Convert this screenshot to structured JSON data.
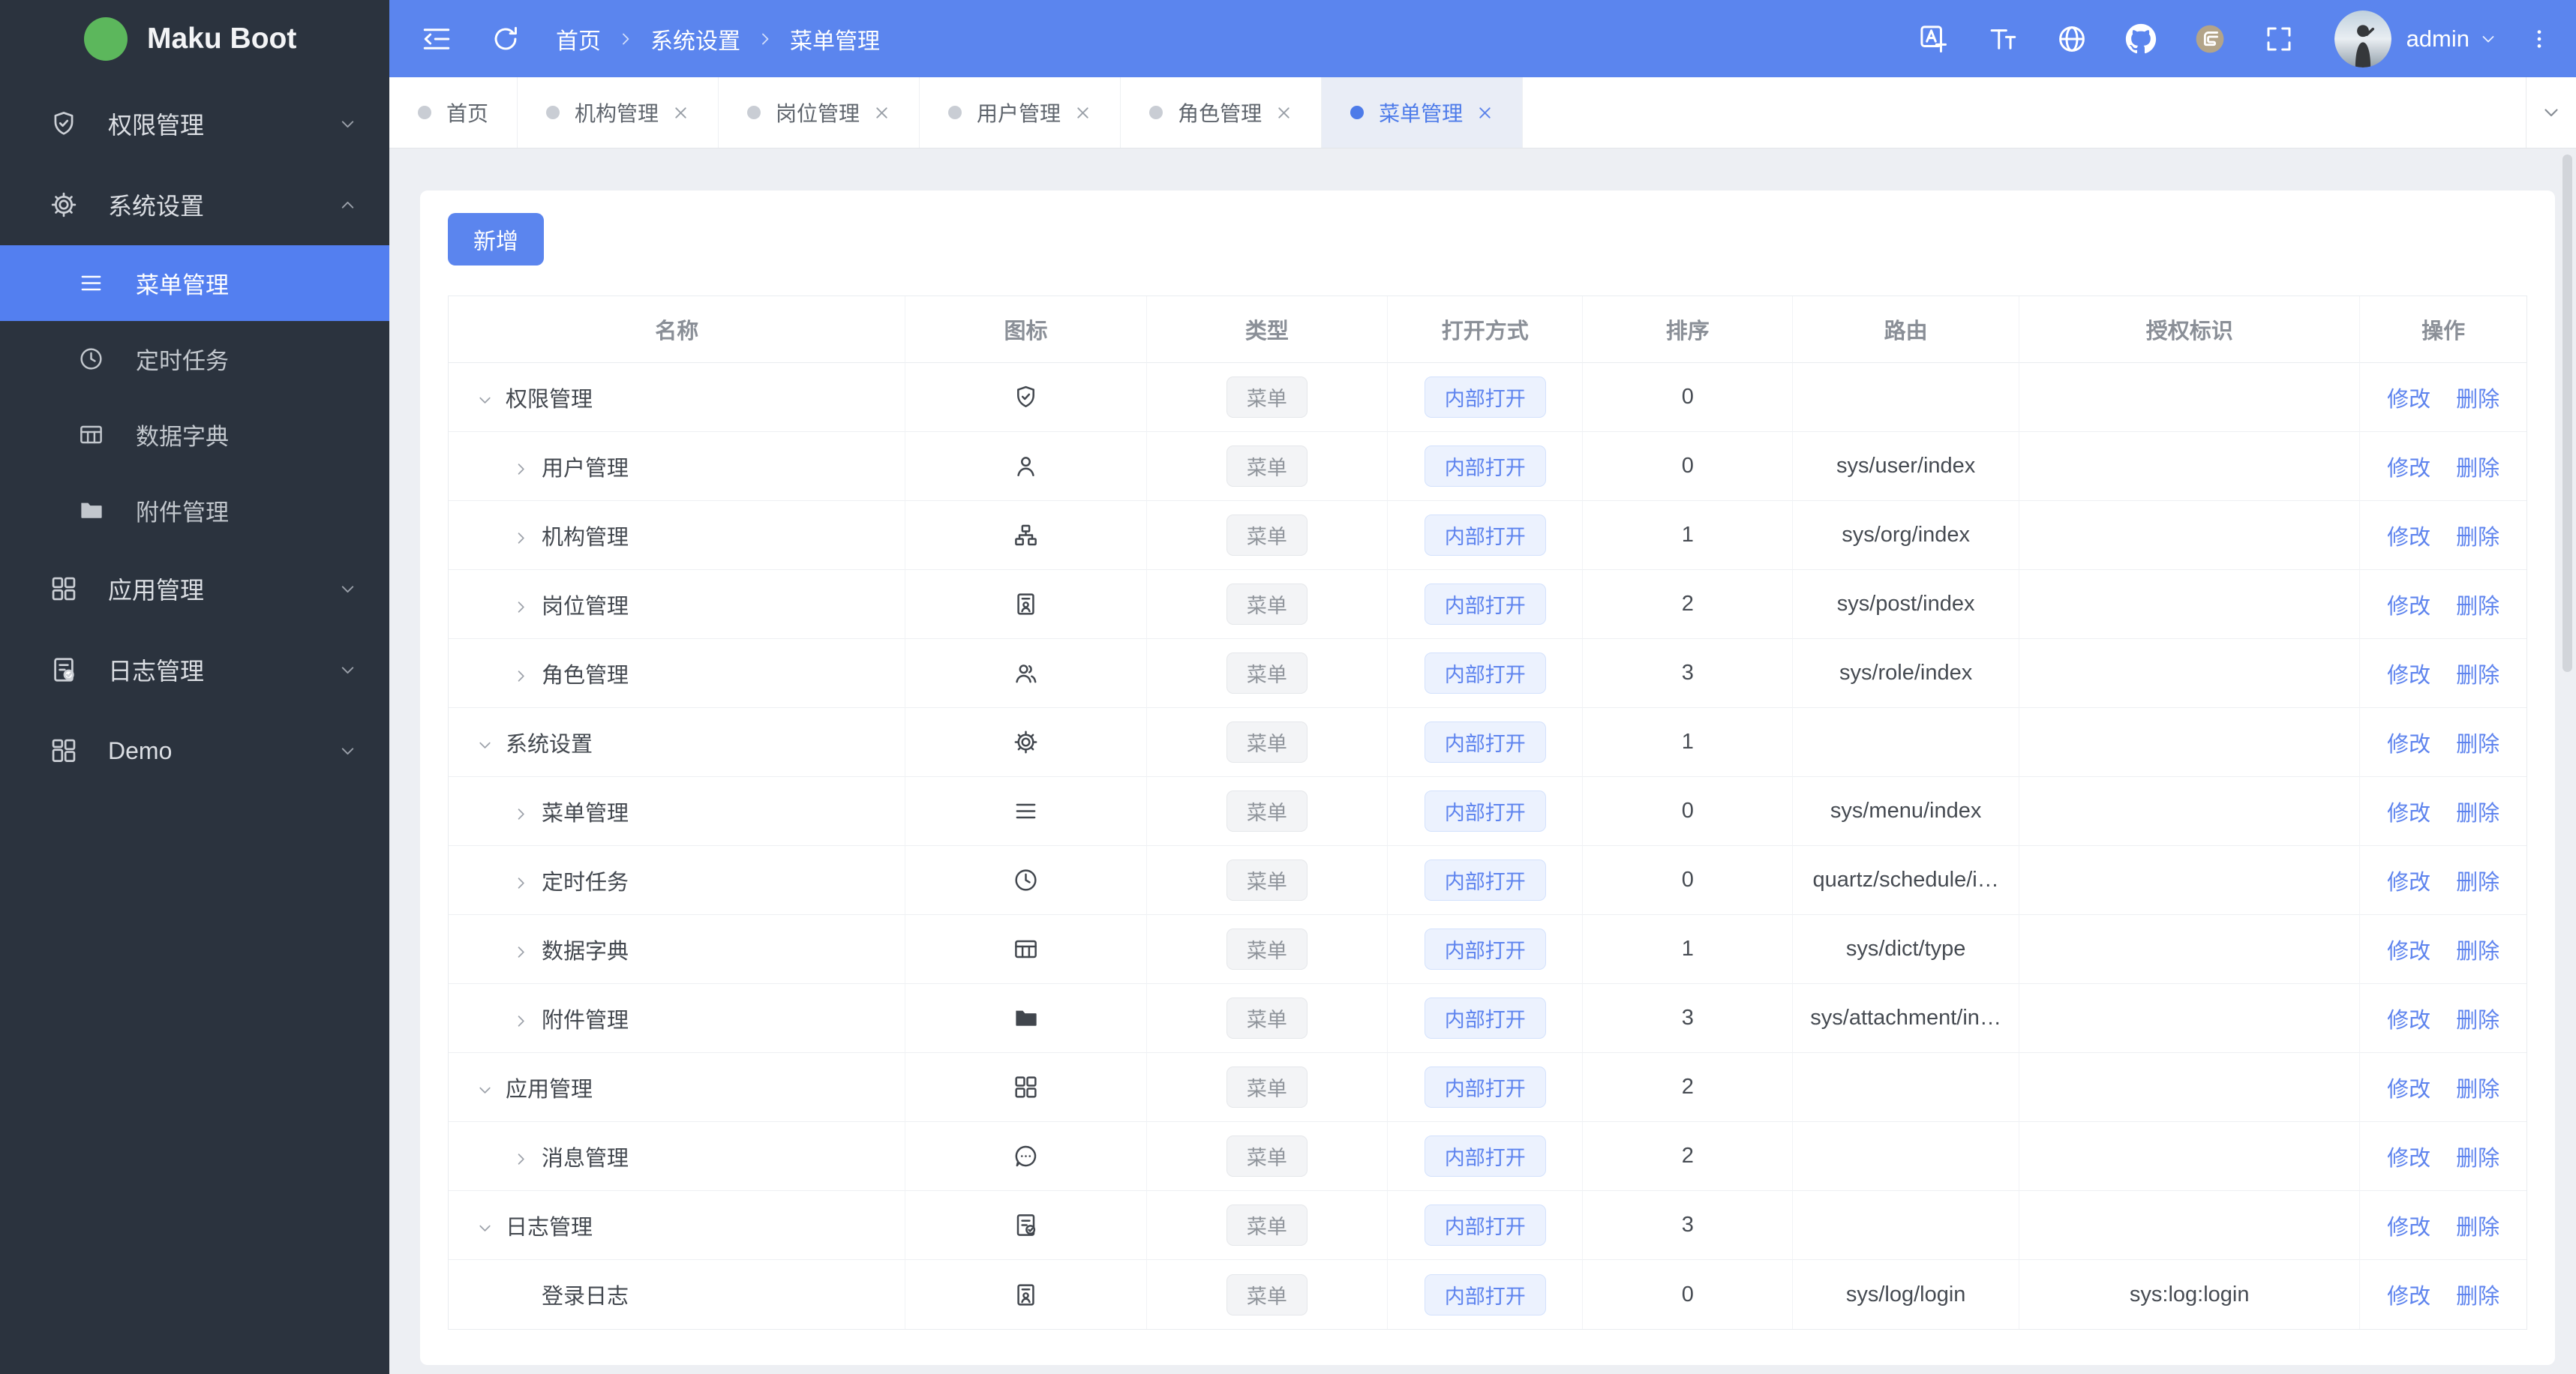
{
  "app": {
    "logo_text": "Maku Boot"
  },
  "colors": {
    "header_blue": "#5b85ee",
    "sidebar_dark": "#2b333e",
    "active_blue": "#537ff0",
    "link_blue": "#5d83ee",
    "active_tab_bg": "#e9edf6",
    "tag_menu_bg": "#f3f4f6",
    "tag_open_bg": "#ecf2fe"
  },
  "header": {
    "left_icons": [
      "indent-collapse-icon",
      "refresh-icon"
    ],
    "breadcrumb": [
      "首页",
      "系统设置",
      "菜单管理"
    ],
    "right_icons": [
      "translate-icon",
      "font-size-icon",
      "globe-icon",
      "github-icon",
      "gitee-icon",
      "fullscreen-icon"
    ],
    "user": {
      "name": "admin"
    }
  },
  "sidebar": {
    "items": [
      {
        "icon": "shield-check-icon",
        "label": "权限管理",
        "state": "collapsed",
        "children": []
      },
      {
        "icon": "gear-icon",
        "label": "系统设置",
        "state": "expanded",
        "children": [
          {
            "icon": "menu-icon",
            "label": "菜单管理",
            "active": true
          },
          {
            "icon": "clock-icon",
            "label": "定时任务",
            "active": false
          },
          {
            "icon": "dict-icon",
            "label": "数据字典",
            "active": false
          },
          {
            "icon": "folder-icon",
            "label": "附件管理",
            "active": false
          }
        ]
      },
      {
        "icon": "apps-icon",
        "label": "应用管理",
        "state": "collapsed",
        "children": []
      },
      {
        "icon": "log-icon",
        "label": "日志管理",
        "state": "collapsed",
        "children": []
      },
      {
        "icon": "demo-icon",
        "label": "Demo",
        "state": "collapsed",
        "children": []
      }
    ]
  },
  "tabs": [
    {
      "label": "首页",
      "closable": false,
      "active": false
    },
    {
      "label": "机构管理",
      "closable": true,
      "active": false
    },
    {
      "label": "岗位管理",
      "closable": true,
      "active": false
    },
    {
      "label": "用户管理",
      "closable": true,
      "active": false
    },
    {
      "label": "角色管理",
      "closable": true,
      "active": false
    },
    {
      "label": "菜单管理",
      "closable": true,
      "active": true
    }
  ],
  "page": {
    "add_button": "新增"
  },
  "table": {
    "columns": [
      "名称",
      "图标",
      "类型",
      "打开方式",
      "排序",
      "路由",
      "授权标识",
      "操作"
    ],
    "ops": [
      "修改",
      "删除"
    ],
    "rows": [
      {
        "level": 0,
        "arrow": "down",
        "name": "权限管理",
        "icon": "shield-check-icon",
        "type": "菜单",
        "open_mode": "内部打开",
        "sort": "0",
        "route": "",
        "auth": ""
      },
      {
        "level": 1,
        "arrow": "right",
        "name": "用户管理",
        "icon": "user-icon",
        "type": "菜单",
        "open_mode": "内部打开",
        "sort": "0",
        "route": "sys/user/index",
        "auth": ""
      },
      {
        "level": 1,
        "arrow": "right",
        "name": "机构管理",
        "icon": "org-icon",
        "type": "菜单",
        "open_mode": "内部打开",
        "sort": "1",
        "route": "sys/org/index",
        "auth": ""
      },
      {
        "level": 1,
        "arrow": "right",
        "name": "岗位管理",
        "icon": "badge-icon",
        "type": "菜单",
        "open_mode": "内部打开",
        "sort": "2",
        "route": "sys/post/index",
        "auth": ""
      },
      {
        "level": 1,
        "arrow": "right",
        "name": "角色管理",
        "icon": "users-icon",
        "type": "菜单",
        "open_mode": "内部打开",
        "sort": "3",
        "route": "sys/role/index",
        "auth": ""
      },
      {
        "level": 0,
        "arrow": "down",
        "name": "系统设置",
        "icon": "gear-icon",
        "type": "菜单",
        "open_mode": "内部打开",
        "sort": "1",
        "route": "",
        "auth": ""
      },
      {
        "level": 1,
        "arrow": "right",
        "name": "菜单管理",
        "icon": "menu-icon",
        "type": "菜单",
        "open_mode": "内部打开",
        "sort": "0",
        "route": "sys/menu/index",
        "auth": ""
      },
      {
        "level": 1,
        "arrow": "right",
        "name": "定时任务",
        "icon": "clock-icon",
        "type": "菜单",
        "open_mode": "内部打开",
        "sort": "0",
        "route": "quartz/schedule/i…",
        "auth": ""
      },
      {
        "level": 1,
        "arrow": "right",
        "name": "数据字典",
        "icon": "dict-icon",
        "type": "菜单",
        "open_mode": "内部打开",
        "sort": "1",
        "route": "sys/dict/type",
        "auth": ""
      },
      {
        "level": 1,
        "arrow": "right",
        "name": "附件管理",
        "icon": "folder-icon",
        "type": "菜单",
        "open_mode": "内部打开",
        "sort": "3",
        "route": "sys/attachment/in…",
        "auth": ""
      },
      {
        "level": 0,
        "arrow": "down",
        "name": "应用管理",
        "icon": "apps-icon",
        "type": "菜单",
        "open_mode": "内部打开",
        "sort": "2",
        "route": "",
        "auth": ""
      },
      {
        "level": 1,
        "arrow": "right",
        "name": "消息管理",
        "icon": "chat-icon",
        "type": "菜单",
        "open_mode": "内部打开",
        "sort": "2",
        "route": "",
        "auth": ""
      },
      {
        "level": 0,
        "arrow": "down",
        "name": "日志管理",
        "icon": "log-icon",
        "type": "菜单",
        "open_mode": "内部打开",
        "sort": "3",
        "route": "",
        "auth": ""
      },
      {
        "level": 1,
        "arrow": "none",
        "name": "登录日志",
        "icon": "badge-icon",
        "type": "菜单",
        "open_mode": "内部打开",
        "sort": "0",
        "route": "sys/log/login",
        "auth": "sys:log:login"
      }
    ]
  }
}
